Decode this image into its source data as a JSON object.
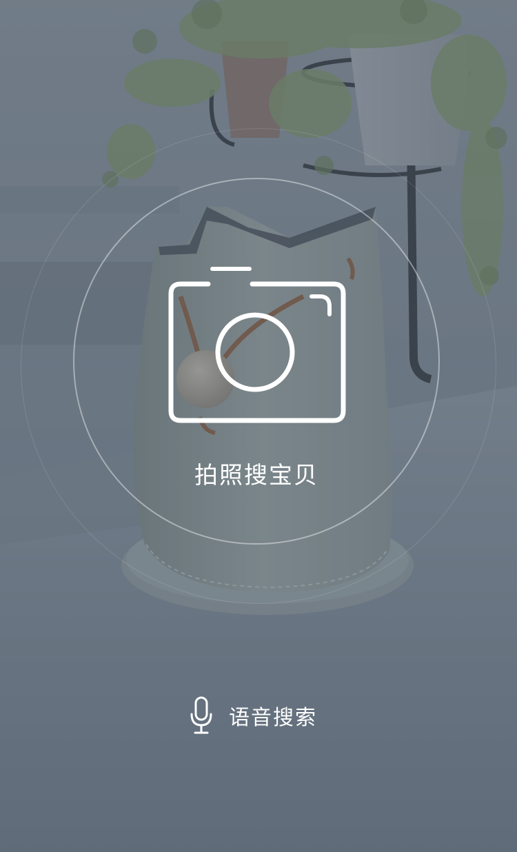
{
  "camera_search": {
    "label": "拍照搜宝贝",
    "icon": "camera-icon"
  },
  "voice_search": {
    "label": "语音搜索",
    "icon": "microphone-icon"
  },
  "background": {
    "overlay_color": "#5a6675"
  }
}
